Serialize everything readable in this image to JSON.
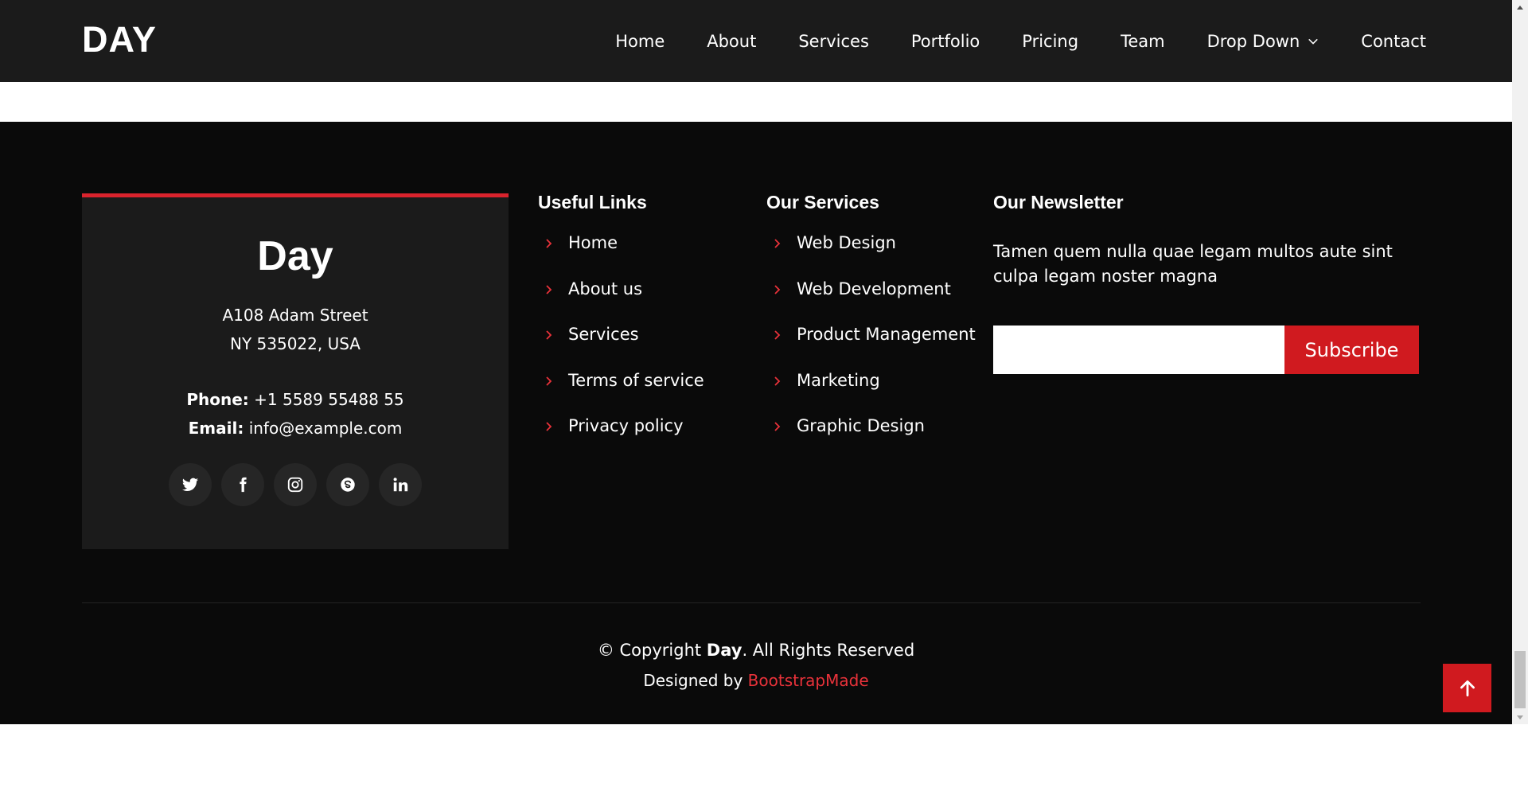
{
  "brand": "DAY",
  "nav": {
    "items": [
      "Home",
      "About",
      "Services",
      "Portfolio",
      "Pricing",
      "Team",
      "Drop Down",
      "Contact"
    ]
  },
  "info": {
    "title": "Day",
    "address_line1": "A108 Adam Street",
    "address_line2": "NY 535022, USA",
    "phone_label": "Phone:",
    "phone": "+1 5589 55488 55",
    "email_label": "Email:",
    "email": "info@example.com",
    "social_icons": [
      "twitter-icon",
      "facebook-icon",
      "instagram-icon",
      "skype-icon",
      "linkedin-icon"
    ]
  },
  "useful_links": {
    "title": "Useful Links",
    "items": [
      "Home",
      "About us",
      "Services",
      "Terms of service",
      "Privacy policy"
    ]
  },
  "services": {
    "title": "Our Services",
    "items": [
      "Web Design",
      "Web Development",
      "Product Management",
      "Marketing",
      "Graphic Design"
    ]
  },
  "newsletter": {
    "title": "Our Newsletter",
    "text": "Tamen quem nulla quae legam multos aute sint culpa legam noster magna",
    "input_value": "",
    "button": "Subscribe"
  },
  "copyright": {
    "prefix": "© Copyright ",
    "brand": "Day",
    "suffix": ". All Rights Reserved"
  },
  "credits": {
    "prefix": "Designed by ",
    "link": "BootstrapMade"
  },
  "colors": {
    "accent": "#d01a1f",
    "header_bg": "#1b1b1b",
    "footer_bg": "#0a0a0a"
  }
}
